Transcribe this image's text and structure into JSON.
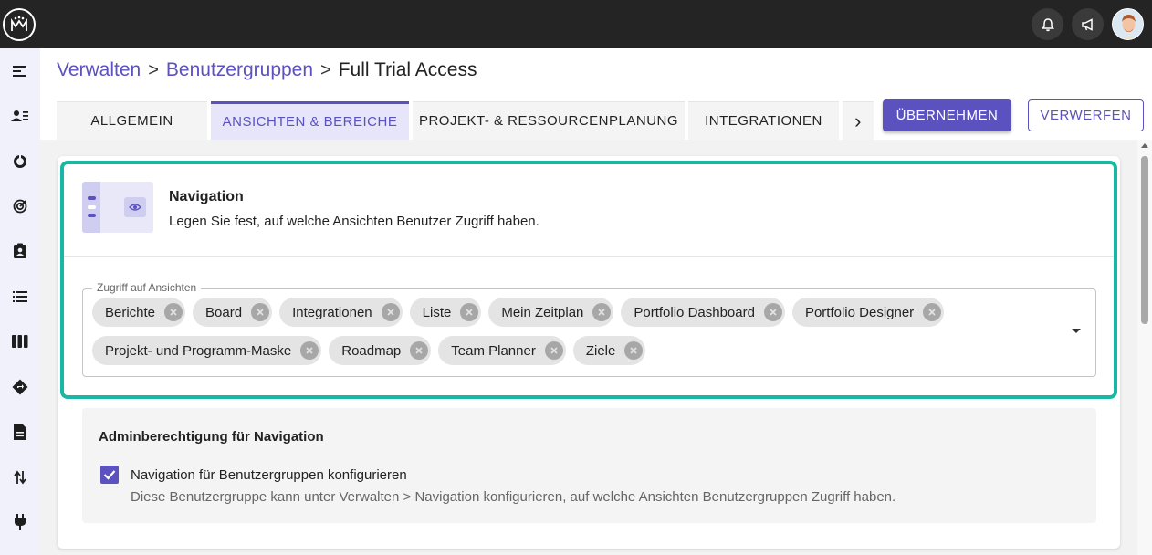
{
  "breadcrumb": {
    "level1": "Verwalten",
    "level2": "Benutzergruppen",
    "current": "Full Trial Access",
    "separator": ">"
  },
  "tabs": [
    {
      "label": "ALLGEMEIN",
      "active": false
    },
    {
      "label": "ANSICHTEN & BEREICHE",
      "active": true
    },
    {
      "label": "PROJEKT- & RESSOURCENPLANUNG",
      "active": false
    },
    {
      "label": "INTEGRATIONEN",
      "active": false
    }
  ],
  "tab_more_glyph": "›",
  "actions": {
    "apply_label": "ÜBERNEHMEN",
    "discard_label": "VERWERFEN"
  },
  "navigation": {
    "title": "Navigation",
    "description": "Legen Sie fest, auf welche Ansichten Benutzer Zugriff haben."
  },
  "views_field": {
    "legend": "Zugriff auf Ansichten",
    "chips": [
      "Berichte",
      "Board",
      "Integrationen",
      "Liste",
      "Mein Zeitplan",
      "Portfolio Dashboard",
      "Portfolio Designer",
      "Projekt- und Programm-Maske",
      "Roadmap",
      "Team Planner",
      "Ziele"
    ]
  },
  "admin": {
    "title": "Adminberechtigung für Navigation",
    "checkbox_label": "Navigation für Benutzergruppen konfigurieren",
    "checkbox_checked": true,
    "checkbox_description": "Diese Benutzergruppe kann unter Verwalten > Navigation konfigurieren, auf welche Ansichten Benutzergruppen Zugriff haben."
  },
  "colors": {
    "accent": "#5b52c0",
    "highlight": "#18b9a4",
    "topbar": "#242424",
    "sidebar": "#f0f1fb"
  },
  "sidebar_icons": [
    "menu-icon",
    "users-icon",
    "dashboard-icon",
    "target-icon",
    "assignment-icon",
    "list-icon",
    "board-icon",
    "roadmap-icon",
    "document-icon",
    "swap-icon",
    "plug-icon"
  ]
}
